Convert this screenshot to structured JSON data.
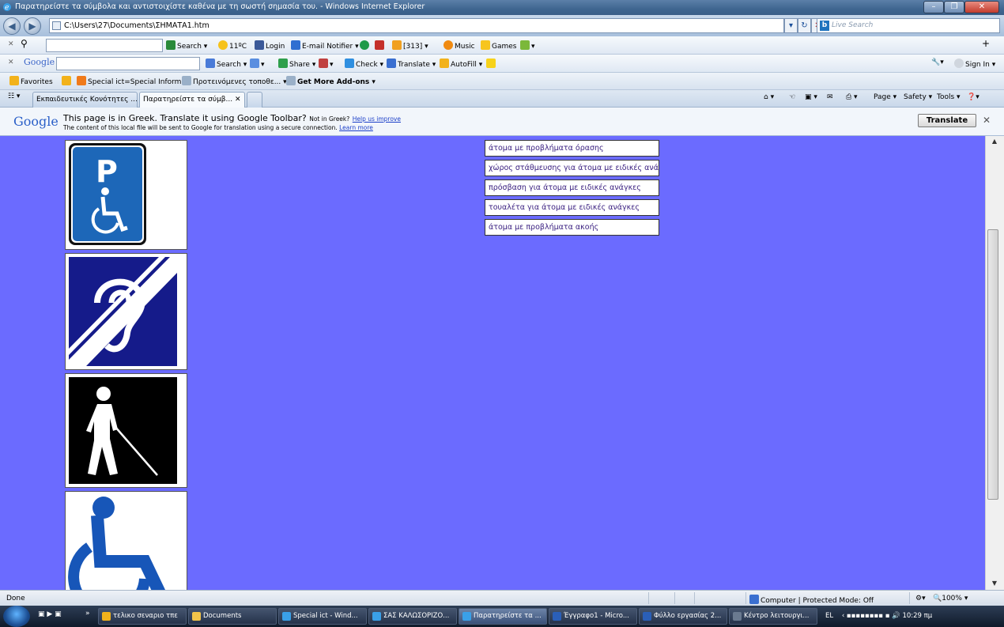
{
  "window": {
    "title": "Παρατηρείστε τα σύμβολα και αντιστοιχίστε καθένα με τη σωστή σημασία του. - Windows Internet Explorer",
    "controls": [
      "–",
      "❐",
      "✕"
    ]
  },
  "address_bar": {
    "url": "C:\\Users\\27\\Documents\\ΣΗΜΑΤΑ1.htm",
    "live_search_placeholder": "Live Search"
  },
  "toolbar1": {
    "search_label": "Search",
    "weather": "11ºC",
    "login": "Login",
    "email_notifier": "E-mail Notifier",
    "count": "[313]",
    "music": "Music",
    "games": "Games"
  },
  "toolbar2": {
    "google_label": "Google",
    "search_label": "Search",
    "share_label": "Share",
    "check_label": "Check",
    "translate_label": "Translate",
    "autofill_label": "AutoFill",
    "signin_label": "Sign In"
  },
  "favorites_bar": {
    "favorites_label": "Favorites",
    "items": [
      "Special ict=Special Inform...",
      "Προτεινόμενες τοποθε...",
      "Get More Add-ons"
    ]
  },
  "tabs": [
    {
      "label": "Εκπαιδευτικές Κονότητες ...",
      "active": false
    },
    {
      "label": "Παρατηρείστε τα σύμβ...",
      "active": true
    }
  ],
  "command_bar": {
    "page": "Page",
    "safety": "Safety",
    "tools": "Tools"
  },
  "translate_bar": {
    "logo": "Google",
    "message": "This page is in Greek.  Translate it using Google Toolbar?",
    "not_in_greek": "Not in Greek?",
    "help_link": "Help us improve",
    "sub_message": "The content of this local file will be sent to Google for translation using a secure connection.",
    "learn_more": "Learn more",
    "translate_button": "Translate"
  },
  "symbols": [
    "parking-disabled-icon",
    "hearing-impaired-icon",
    "visually-impaired-icon",
    "wheelchair-icon"
  ],
  "labels": [
    "άτομα με προβλήματα όρασης",
    "χώρος στάθμευσης για άτομα με ειδικές ανάγκες",
    "πρόσβαση για άτομα με ειδικές ανάγκες",
    "τουαλέτα για άτομα με ειδικές ανάγκες",
    "άτομα με προβλήματα ακοής"
  ],
  "status_bar": {
    "status": "Done",
    "zone": "Computer | Protected Mode: Off",
    "zoom": "100%"
  },
  "taskbar": {
    "tasks": [
      {
        "label": "τελικο σεναριο τπε",
        "active": false
      },
      {
        "label": "Documents",
        "active": false
      },
      {
        "label": "Special ict - Wind...",
        "active": false
      },
      {
        "label": "ΣΑΣ ΚΑΛΩΣΟΡΙΖΟ...",
        "active": false
      },
      {
        "label": "Παρατηρείστε τα ...",
        "active": true
      },
      {
        "label": "Έγγραφο1 - Micro...",
        "active": false
      },
      {
        "label": "Φύλλο εργασίας 2...",
        "active": false
      },
      {
        "label": "Κέντρο λειτουργι...",
        "active": false
      }
    ],
    "language": "EL",
    "clock": "10:29 πμ"
  }
}
